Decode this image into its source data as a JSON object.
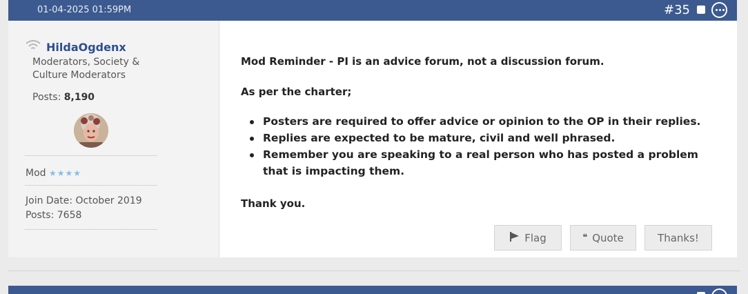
{
  "post": {
    "date": "01-04-2025 01:59PM",
    "number": "#35"
  },
  "user": {
    "name": "HildaOgdenx",
    "title": "Moderators, Society & Culture Moderators",
    "posts_label": "Posts:",
    "posts_value": "8,190",
    "rank": "Mod",
    "rank_stars": "★★★★",
    "join_date": "Join Date: October 2019",
    "post_total": "Posts: 7658"
  },
  "message": {
    "heading": "Mod Reminder - PI is an advice forum, not a discussion forum.",
    "intro": "As per the charter;",
    "bullets": [
      "Posters are required to offer advice or opinion to the OP in their replies.",
      "Replies are expected to be mature, civil and well phrased.",
      "Remember you are speaking to a real person who has posted a problem that is impacting them."
    ],
    "closing": "Thank you."
  },
  "actions": {
    "flag": "Flag",
    "quote": "Quote",
    "thanks": "Thanks!"
  },
  "icons": {
    "online": "wifi-icon",
    "more": "more-options-icon",
    "select": "select-checkbox-icon",
    "flag": "flag-icon",
    "quote": "quote-icon"
  },
  "colors": {
    "header": "#3c5a8f",
    "username": "#2c4f8e",
    "stars": "#88bde6"
  }
}
